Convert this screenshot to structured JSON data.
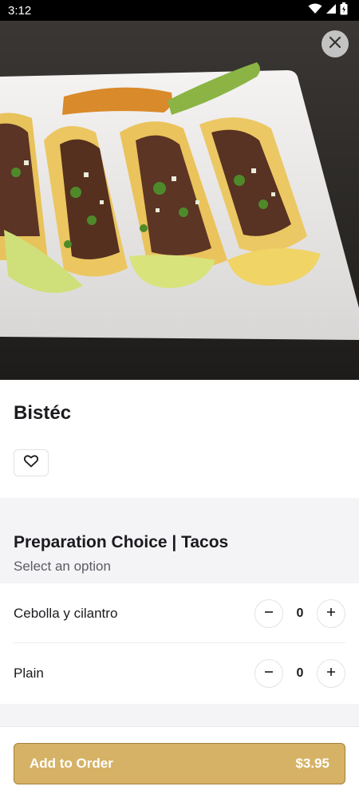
{
  "status_bar": {
    "time": "3:12"
  },
  "item": {
    "title": "Bistéc"
  },
  "section": {
    "title": "Preparation Choice | Tacos",
    "subtitle": "Select an option",
    "options": [
      {
        "label": "Cebolla y cilantro",
        "count": "0"
      },
      {
        "label": "Plain",
        "count": "0"
      }
    ]
  },
  "footer": {
    "button_label": "Add to Order",
    "price": "$3.95"
  },
  "colors": {
    "accent": "#d6b266",
    "accent_border": "#a4813a",
    "section_bg": "#f4f4f7"
  },
  "icons": [
    "wifi-icon",
    "signal-icon",
    "battery-icon",
    "close-icon",
    "heart-icon",
    "minus-icon",
    "plus-icon"
  ]
}
